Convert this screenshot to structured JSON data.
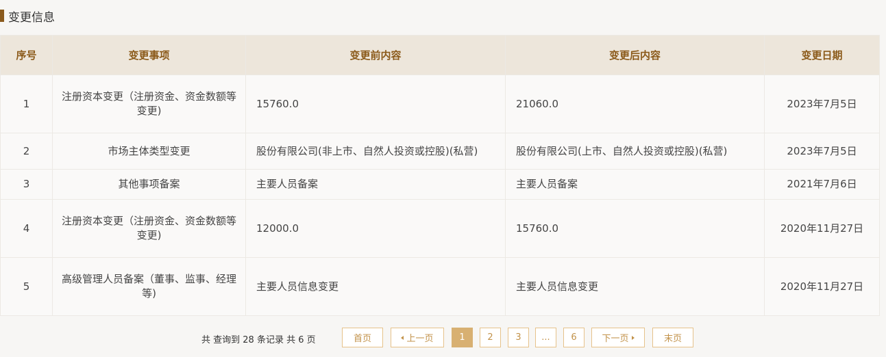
{
  "section": {
    "title": "变更信息"
  },
  "table": {
    "headers": [
      "序号",
      "变更事项",
      "变更前内容",
      "变更后内容",
      "变更日期"
    ],
    "rows": [
      {
        "no": "1",
        "item": "注册资本变更（注册资金、资金数额等变更)",
        "before": "15760.0",
        "after": "21060.0",
        "date": "2023年7月5日"
      },
      {
        "no": "2",
        "item": "市场主体类型变更",
        "before": "股份有限公司(非上市、自然人投资或控股)(私营)",
        "after": "股份有限公司(上市、自然人投资或控股)(私营)",
        "date": "2023年7月5日"
      },
      {
        "no": "3",
        "item": "其他事项备案",
        "before": "主要人员备案",
        "after": "主要人员备案",
        "date": "2021年7月6日"
      },
      {
        "no": "4",
        "item": "注册资本变更（注册资金、资金数额等变更)",
        "before": "12000.0",
        "after": "15760.0",
        "date": "2020年11月27日"
      },
      {
        "no": "5",
        "item": "高级管理人员备案（董事、监事、经理等)",
        "before": "主要人员信息变更",
        "after": "主要人员信息变更",
        "date": "2020年11月27日"
      }
    ]
  },
  "pager": {
    "summary": "共 查询到 28 条记录 共 6 页",
    "first": "首页",
    "prev": "上一页",
    "pages": [
      "1",
      "2",
      "3",
      "...",
      "6"
    ],
    "current": "1",
    "next": "下一页",
    "last": "末页"
  },
  "colors": {
    "header_bg": "#ede6db",
    "header_text": "#8b5a1a",
    "title_bar": "#8a5a1c",
    "pager_border": "#e6c28a",
    "pager_active": "#d8b072"
  }
}
